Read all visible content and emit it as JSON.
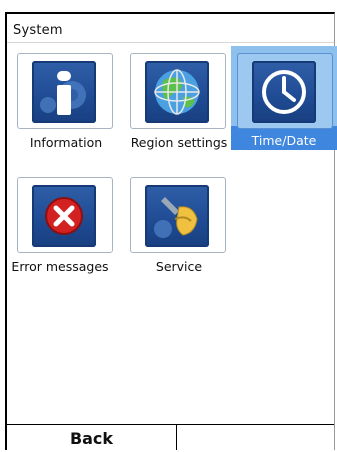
{
  "title": "System",
  "tiles": [
    {
      "label": "Information",
      "icon": "information-icon",
      "selected": false
    },
    {
      "label": "Region settings",
      "icon": "globe-icon",
      "selected": false
    },
    {
      "label": "Time/Date",
      "icon": "clock-icon",
      "selected": true
    },
    {
      "label": "Error messages",
      "icon": "error-icon",
      "selected": false
    },
    {
      "label": "Service",
      "icon": "service-icon",
      "selected": false
    }
  ],
  "softkeys": {
    "left": "Back",
    "right": ""
  },
  "colors": {
    "icon_blue": "#1f4b93",
    "selection_blue": "#3f86df",
    "selection_light": "#8ec0ee",
    "error_red": "#d32020"
  }
}
